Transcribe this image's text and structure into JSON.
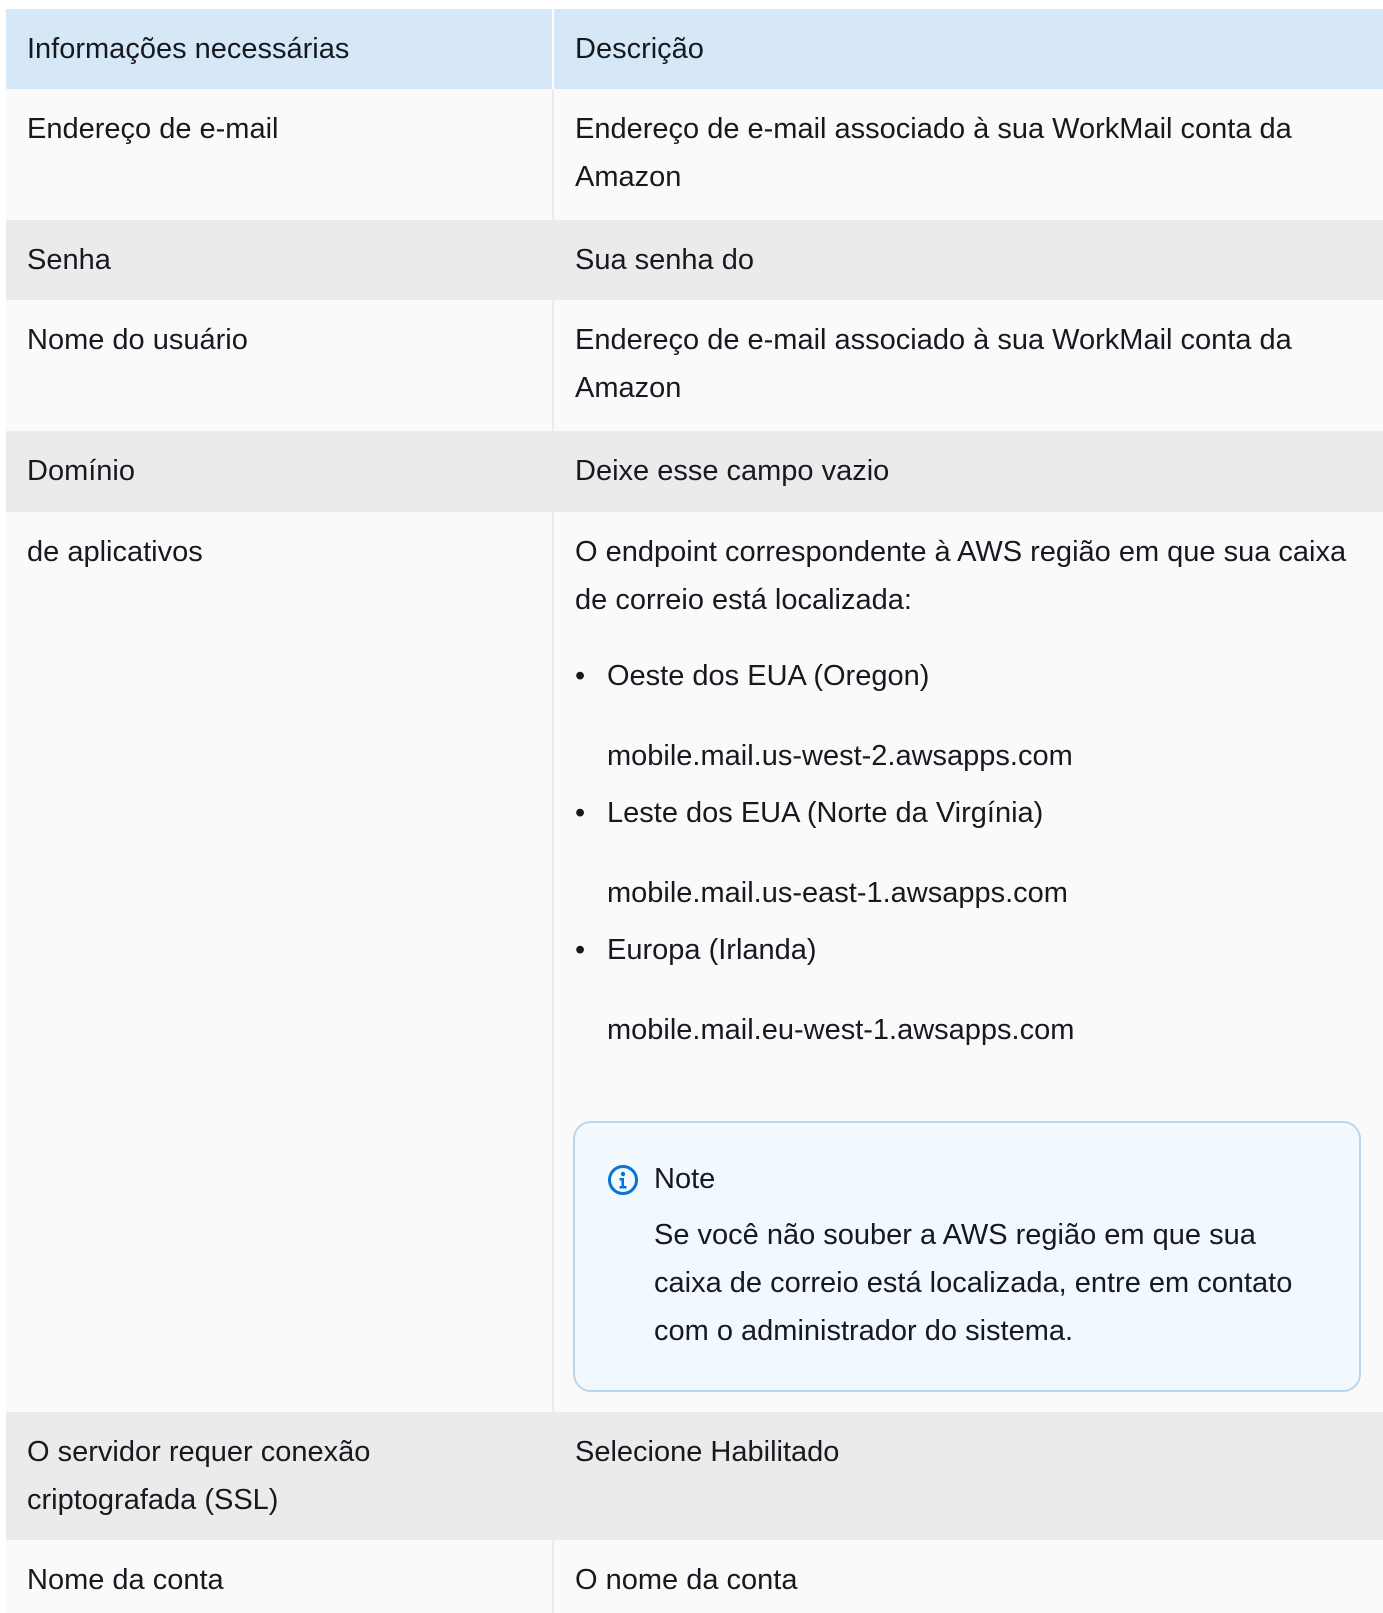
{
  "table": {
    "headers": [
      "Informações necessárias",
      "Descrição"
    ],
    "rows": [
      {
        "label": "Endereço de e-mail",
        "description": "Endereço de e-mail associado à sua WorkMail conta da Amazon"
      },
      {
        "label": "Senha",
        "description": "Sua senha do"
      },
      {
        "label": "Nome do usuário",
        "description": "Endereço de e-mail associado à sua WorkMail conta da Amazon"
      },
      {
        "label": "Domínio",
        "description": "Deixe esse campo vazio"
      },
      {
        "label": "de aplicativos",
        "description": "O endpoint correspondente à AWS região em que sua caixa de correio está localizada:",
        "regions": [
          {
            "name": "Oeste dos EUA (Oregon)",
            "endpoint": "mobile.mail.us-west-2.awsapps.com"
          },
          {
            "name": "Leste dos EUA (Norte da Virgínia)",
            "endpoint": "mobile.mail.us-east-1.awsapps.com"
          },
          {
            "name": "Europa (Irlanda)",
            "endpoint": "mobile.mail.eu-west-1.awsapps.com"
          }
        ],
        "note": {
          "icon": "info-icon",
          "title": "Note",
          "body": "Se você não souber a AWS região em que sua caixa de correio está localizada, entre em contato com o administrador do sistema."
        }
      },
      {
        "label": "O servidor requer conexão criptografada (SSL)",
        "description": "Selecione Habilitado"
      },
      {
        "label": "Nome da conta",
        "description": "O nome da conta"
      }
    ]
  },
  "colors": {
    "header_bg": "#d6e8f7",
    "row_odd_bg": "#fafafa",
    "row_even_bg": "#ebebeb",
    "note_bg": "#f1f8fe",
    "note_border": "#b8d6ee",
    "info_icon": "#0972d3"
  }
}
